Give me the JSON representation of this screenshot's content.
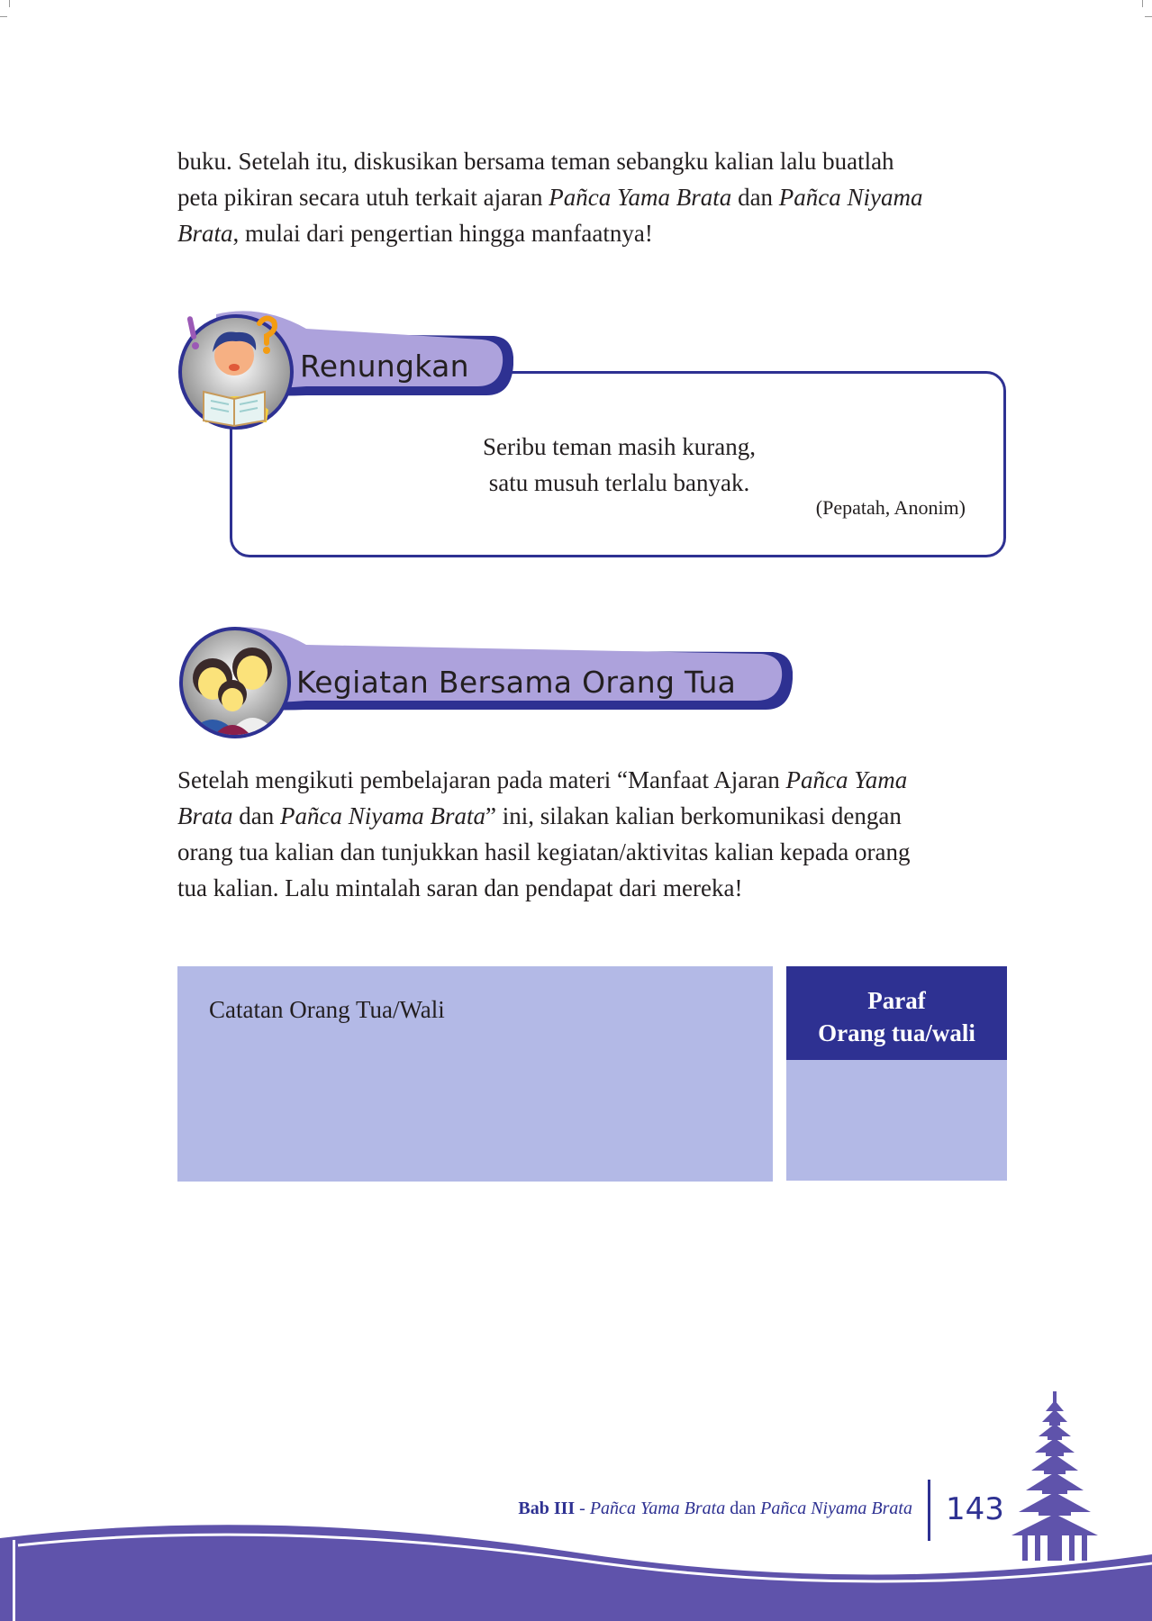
{
  "intro": {
    "line1": "buku. Setelah itu, diskusikan bersama teman sebangku kalian lalu buatlah",
    "line2_a": "peta pikiran secara utuh terkait ajaran ",
    "line2_b": "Pañca Yama Brata",
    "line2_c": " dan ",
    "line2_d": "Pañca Niyama",
    "line3_a": "Brata",
    "line3_b": ", mulai dari pengertian hingga manfaatnya!"
  },
  "renungkan": {
    "title": "Renungkan",
    "icon": "reading-boy-icon",
    "quote_line1": "Seribu teman masih kurang,",
    "quote_line2": "satu musuh terlalu banyak.",
    "attribution": "(Pepatah, Anonim)"
  },
  "kegiatan": {
    "title": "Kegiatan Bersama Orang Tua",
    "icon": "family-icon",
    "p1_a": "Setelah mengikuti pembelajaran pada materi “Manfaat Ajaran ",
    "p1_b": "Pañca Yama",
    "p2_a": "Brata",
    "p2_b": " dan ",
    "p2_c": "Pañca Niyama Brata",
    "p2_d": "” ini, silakan kalian berkomunikasi dengan",
    "p3": "orang tua kalian dan tunjukkan hasil kegiatan/aktivitas kalian kepada orang",
    "p4": "tua kalian. Lalu mintalah saran dan pendapat dari mereka!"
  },
  "notes": {
    "label": "Catatan Orang Tua/Wali",
    "sign_line1": "Paraf",
    "sign_line2": "Orang tua/wali"
  },
  "footer": {
    "bab": "Bab III",
    "dash": " - ",
    "title_a": "Pañca Yama Brata",
    "title_b": " dan ",
    "title_c": "Pañca Niyama Brata",
    "page": "143",
    "icon": "temple-meru-icon"
  },
  "colors": {
    "navy": "#2e3192",
    "lavender": "#b3b9e6",
    "band": "#ada2dc",
    "wave": "#5f53ab"
  }
}
